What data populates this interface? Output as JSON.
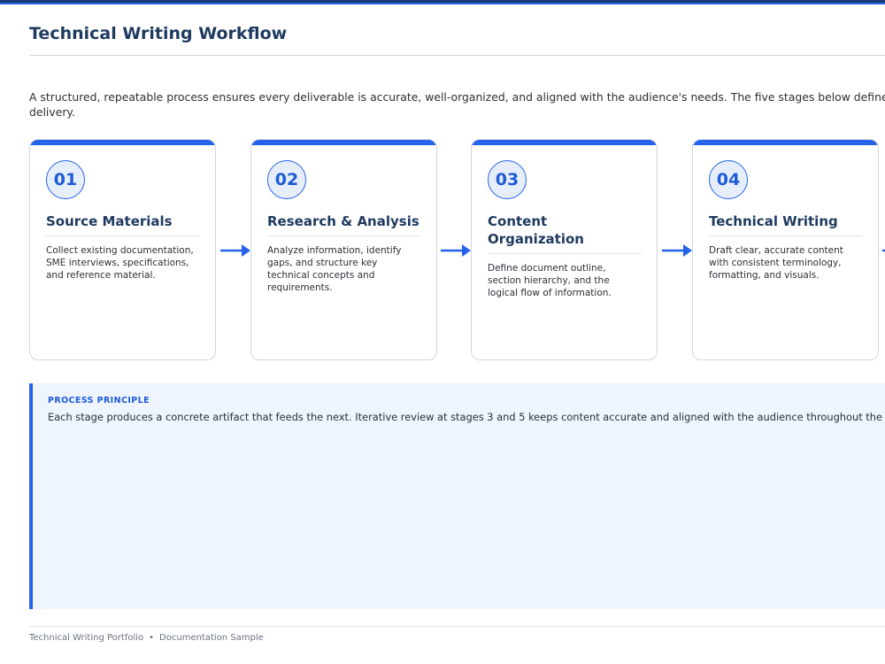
{
  "page": {
    "title": "Technical Writing Workflow",
    "intro_line1": "A structured, repeatable process ensures every deliverable is accurate, well-organized, and aligned with the audience's needs. The five stages below define the wo",
    "intro_line2": "delivery."
  },
  "steps": [
    {
      "number": "01",
      "title": "Source Materials",
      "description": "Collect existing documentation, SME interviews, specifications, and reference material."
    },
    {
      "number": "02",
      "title": "Research & Analysis",
      "description": "Analyze information, identify gaps, and structure key technical concepts and requirements."
    },
    {
      "number": "03",
      "title": "Content Organization",
      "description": "Define document outline, section hierarchy, and the logical flow of information."
    },
    {
      "number": "04",
      "title": "Technical Writing",
      "description": "Draft clear, accurate content with consistent terminology, formatting, and visuals."
    }
  ],
  "principle": {
    "label": "PROCESS PRINCIPLE",
    "text": "Each stage produces a concrete artifact that feeds the next. Iterative review at stages 3 and 5 keeps content accurate and aligned with the audience throughout the eng"
  },
  "footer": {
    "left": "Technical Writing Portfolio",
    "separator": "•",
    "right": "Documentation Sample"
  },
  "colors": {
    "accent": "#2563eb",
    "heading": "#1e3a5f",
    "principle_bg": "#eef5fe"
  },
  "icons": {
    "connector": "arrow-right-icon"
  }
}
